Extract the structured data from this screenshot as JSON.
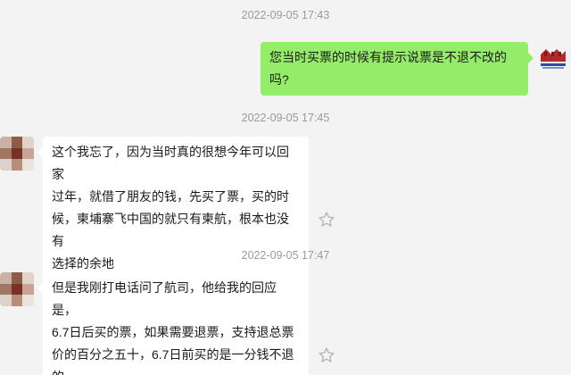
{
  "messages": [
    {
      "time": "2022-09-05 17:43",
      "sender": "me",
      "lines": [
        "您当时买票的时候有提示说票是不退不改的",
        "吗?"
      ]
    },
    {
      "time": "2022-09-05 17:45",
      "sender": "other",
      "lines": [
        "这个我忘了，因为当时真的很想今年可以回家",
        "过年，就借了朋友的钱，先买了票，买的时",
        "候，柬埔寨飞中国的就只有柬航，根本也没有",
        "选择的余地"
      ]
    },
    {
      "time": "2022-09-05 17:47",
      "sender": "other",
      "lines": [
        "但是我刚打电话问了航司，他给我的回应是，",
        "6.7日后买的票，如果需要退票，支持退总票",
        "价的百分之五十，6.7日前买的是一分钱不退",
        "的"
      ]
    }
  ],
  "icons": {
    "favorite": "star-outline-icon"
  },
  "colors": {
    "background": "#f3f3f3",
    "outgoing_bubble": "#95ec69",
    "incoming_bubble": "#ffffff",
    "timestamp": "#9b9b9b",
    "star": "#b5b5b5"
  }
}
